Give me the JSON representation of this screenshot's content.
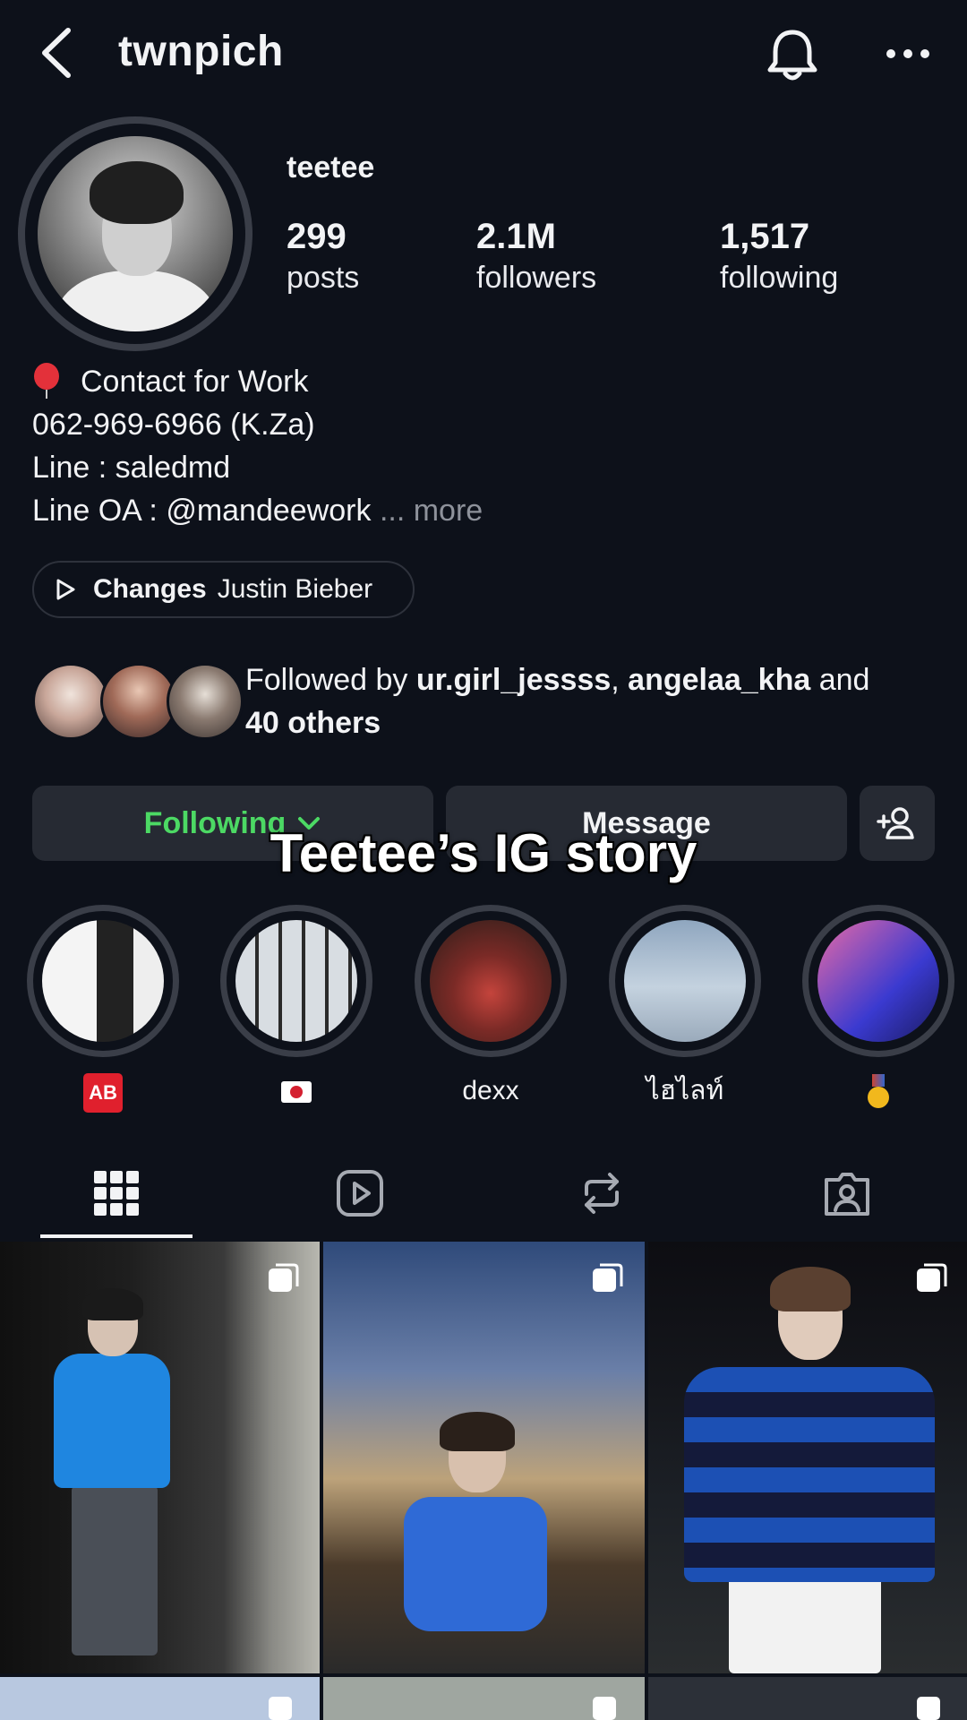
{
  "header": {
    "username": "twnpich"
  },
  "profile": {
    "display_name": "teetee",
    "stats": {
      "posts": {
        "value": "299",
        "label": "posts"
      },
      "followers": {
        "value": "2.1M",
        "label": "followers"
      },
      "following": {
        "value": "1,517",
        "label": "following"
      }
    },
    "bio": {
      "line1": "Contact for Work",
      "line2": "062-969-6966 (K.Za)",
      "line3": "Line : saledmd",
      "line4": "Line OA : @mandeework",
      "more": "... more"
    },
    "music": {
      "song": "Changes",
      "artist": "Justin Bieber"
    },
    "followed_by": {
      "prefix": "Followed by ",
      "user1": "ur.girl_jessss",
      "separator": ", ",
      "user2": "angelaa_kha",
      "and": " and",
      "others": "40 others"
    }
  },
  "actions": {
    "following_label": "Following",
    "message_label": "Message"
  },
  "overlay_caption": "Teetee’s IG story",
  "highlights": [
    {
      "label": "AB"
    },
    {
      "label": "jp-flag"
    },
    {
      "label": "dexx"
    },
    {
      "label": "ไฮไลท์"
    },
    {
      "label": "first-place-medal"
    }
  ],
  "tabs": [
    "grid-icon",
    "reels-icon",
    "reposts-icon",
    "tagged-icon"
  ],
  "colors": {
    "background": "#0d111a",
    "button": "#262a33",
    "following_green": "#4cd964",
    "text": "#f2f3f5",
    "muted": "#8e929b"
  }
}
